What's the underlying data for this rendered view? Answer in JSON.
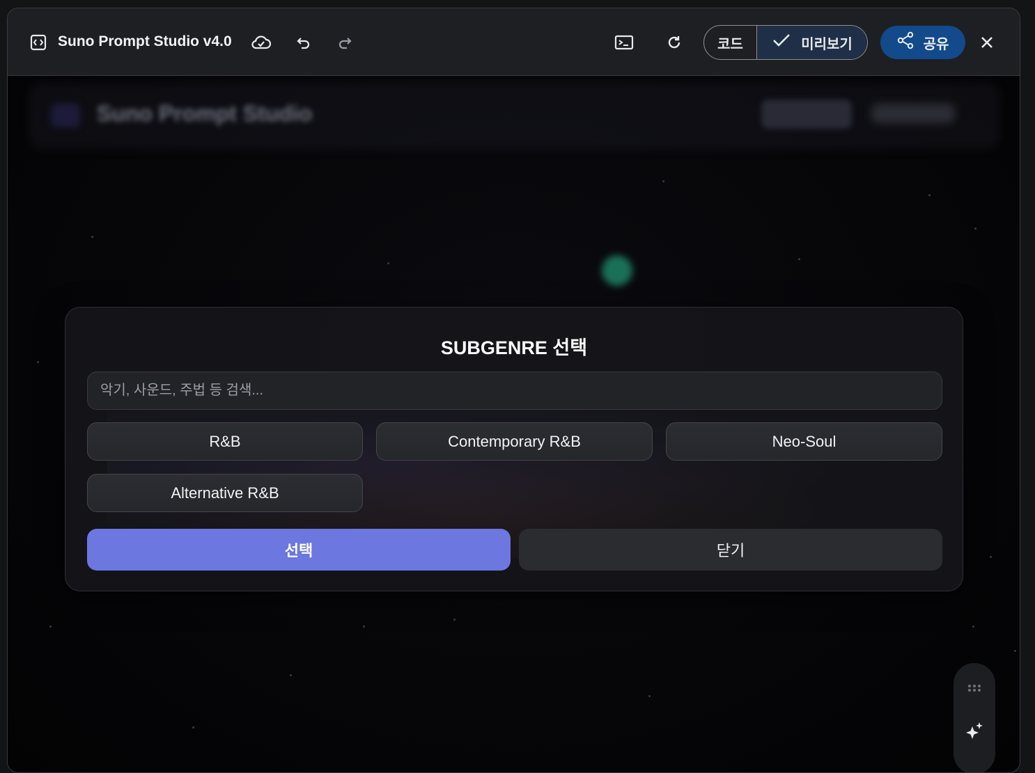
{
  "topbar": {
    "title": "Suno Prompt Studio v4.0",
    "code_label": "코드",
    "preview_label": "미리보기",
    "share_label": "공유"
  },
  "background": {
    "header_title": "Suno Prompt Studio"
  },
  "modal": {
    "title": "SUBGENRE 선택",
    "search_placeholder": "악기, 사운드, 주법 등 검색...",
    "options": [
      "R&B",
      "Contemporary R&B",
      "Neo-Soul",
      "Alternative R&B"
    ],
    "select_label": "선택",
    "close_label": "닫기"
  },
  "colors": {
    "accent": "#6c77e0",
    "share": "#124a8c",
    "preview_active": "#1f2f47"
  },
  "icons": [
    "code-icon",
    "cloud-sync-icon",
    "undo-icon",
    "redo-icon",
    "terminal-icon",
    "refresh-icon",
    "check-icon",
    "share-icon",
    "close-icon",
    "drag-handle-icon",
    "sparkle-icon"
  ]
}
